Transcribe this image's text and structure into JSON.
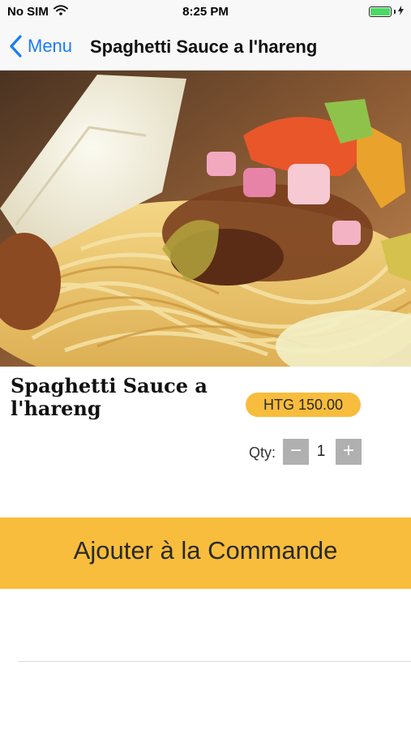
{
  "status_bar": {
    "carrier": "No SIM",
    "time": "8:25 PM",
    "battery_level": 1.0
  },
  "nav": {
    "back_label": "Menu",
    "title": "Spaghetti Sauce a l'hareng"
  },
  "product": {
    "name": "Spaghetti Sauce a l'hareng",
    "price": "HTG 150.00",
    "qty_label": "Qty:",
    "qty_minus": "−",
    "qty_value": "1",
    "qty_plus": "+"
  },
  "actions": {
    "add_to_order": "Ajouter à la Commande"
  },
  "colors": {
    "accent": "#f8bd3c",
    "link": "#1b7cf6",
    "qty_button": "#b0b0b0",
    "battery": "#4cd964"
  },
  "icons": {
    "wifi": "wifi-icon",
    "battery": "battery-icon",
    "charging": "charging-bolt-icon",
    "back": "chevron-left-icon"
  }
}
